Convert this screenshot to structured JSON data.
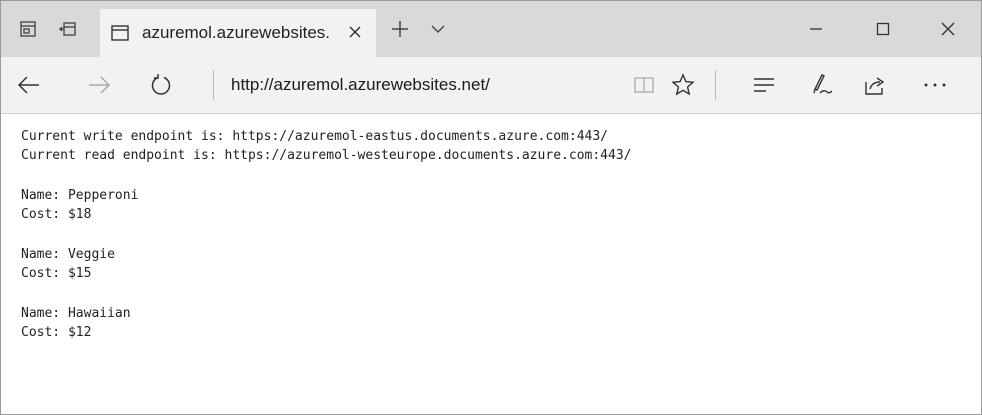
{
  "browser": {
    "tab": {
      "title": "azuremol.azurewebsites."
    },
    "address_bar": {
      "url": "http://azuremol.azurewebsites.net/"
    }
  },
  "page": {
    "endpoints": [
      "Current write endpoint is: https://azuremol-eastus.documents.azure.com:443/",
      "Current read endpoint is: https://azuremol-westeurope.documents.azure.com:443/"
    ],
    "items": [
      {
        "name_line": "Name: Pepperoni",
        "cost_line": "Cost: $18"
      },
      {
        "name_line": "Name: Veggie",
        "cost_line": "Cost: $15"
      },
      {
        "name_line": "Name: Hawaiian",
        "cost_line": "Cost: $12"
      }
    ]
  },
  "icons": [
    "tab-preview-icon",
    "set-aside-tabs-icon",
    "page-favicon",
    "close-tab-icon",
    "new-tab-icon",
    "tab-menu-chevron-icon",
    "minimize-icon",
    "maximize-icon",
    "close-window-icon",
    "back-arrow-icon",
    "forward-arrow-icon",
    "refresh-icon",
    "reading-view-icon",
    "favorite-star-icon",
    "hub-icon",
    "web-note-pen-icon",
    "share-icon",
    "more-ellipsis-icon"
  ],
  "colors": {
    "titlebar_bg": "#d9d9d9",
    "toolbar_bg": "#f2f2f2",
    "content_bg": "#ffffff",
    "text": "#222222"
  }
}
